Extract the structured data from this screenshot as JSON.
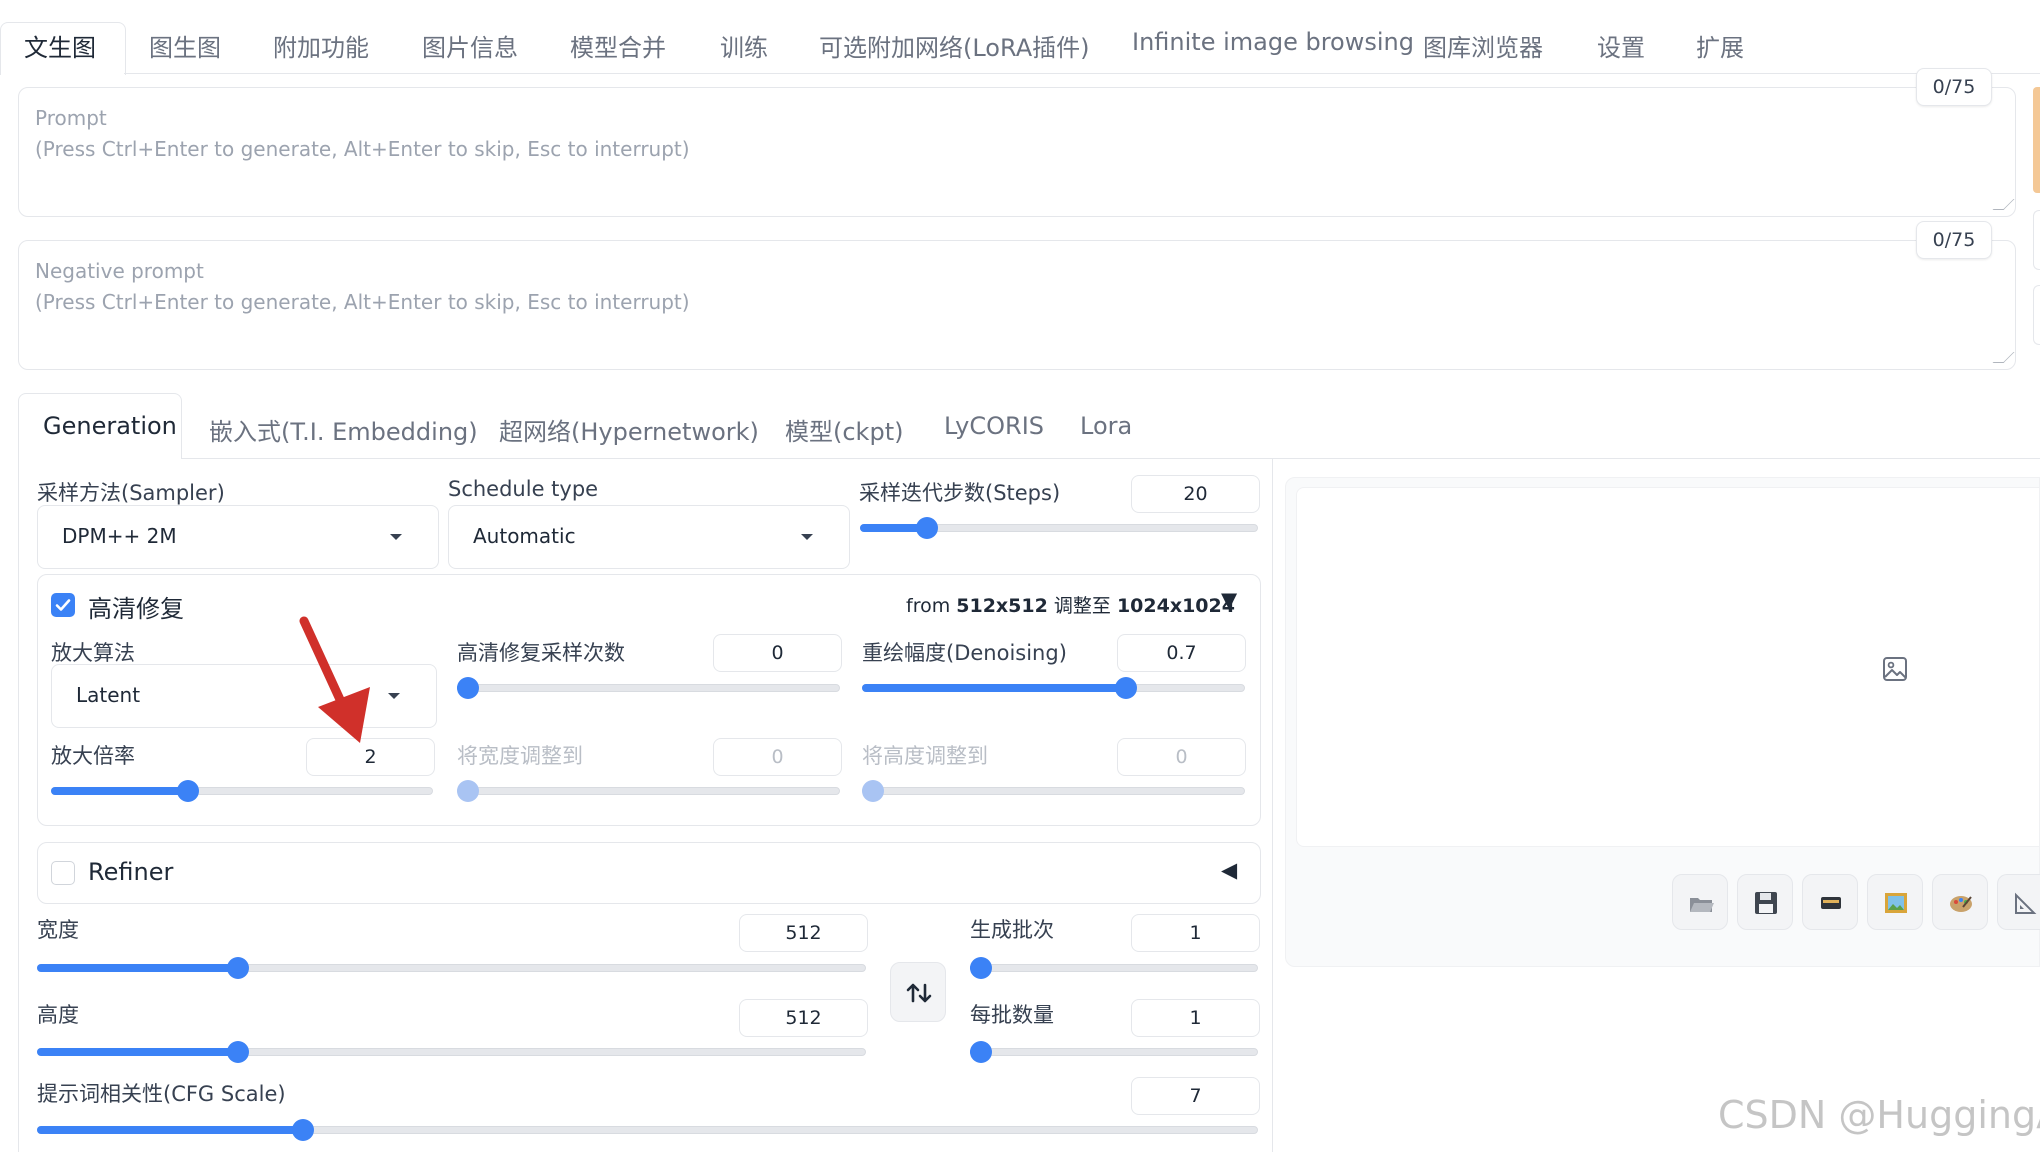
{
  "top_tabs": [
    "文生图",
    "图生图",
    "附加功能",
    "图片信息",
    "模型合并",
    "训练",
    "可选附加网络(LoRA插件)",
    "Infinite image browsing",
    "图库浏览器",
    "设置",
    "扩展"
  ],
  "prompt": {
    "label": "Prompt",
    "hint": "(Press Ctrl+Enter to generate, Alt+Enter to skip, Esc to interrupt)",
    "counter": "0/75"
  },
  "negative_prompt": {
    "label": "Negative prompt",
    "hint": "(Press Ctrl+Enter to generate, Alt+Enter to skip, Esc to interrupt)",
    "counter": "0/75"
  },
  "sub_tabs": [
    "Generation",
    "嵌入式(T.I. Embedding)",
    "超网络(Hypernetwork)",
    "模型(ckpt)",
    "LyCORIS",
    "Lora"
  ],
  "sampler": {
    "label": "采样方法(Sampler)",
    "value": "DPM++ 2M"
  },
  "schedule": {
    "label": "Schedule type",
    "value": "Automatic"
  },
  "steps": {
    "label": "采样迭代步数(Steps)",
    "value": "20",
    "fraction": 0.15
  },
  "hires": {
    "label": "高清修复",
    "checked": true,
    "info_from": "from",
    "info_src": "512x512",
    "info_mid": "调整至",
    "info_dst": "1024x1024",
    "collapse_glyph": "▼",
    "upscaler": {
      "label": "放大算法",
      "value": "Latent"
    },
    "steps": {
      "label": "高清修复采样次数",
      "value": "0",
      "fraction": 0.0
    },
    "denoising": {
      "label": "重绘幅度(Denoising)",
      "value": "0.7",
      "fraction": 0.7
    },
    "scale": {
      "label": "放大倍率",
      "value": "2",
      "fraction": 0.35
    },
    "resize_width": {
      "label": "将宽度调整到",
      "value": "0",
      "fraction": 0.0
    },
    "resize_height": {
      "label": "将高度调整到",
      "value": "0",
      "fraction": 0.0
    }
  },
  "refiner": {
    "label": "Refiner",
    "checked": false,
    "expand_glyph": "◀"
  },
  "width": {
    "label": "宽度",
    "value": "512",
    "fraction": 0.235
  },
  "height": {
    "label": "高度",
    "value": "512",
    "fraction": 0.235
  },
  "batch_count": {
    "label": "生成批次",
    "value": "1",
    "fraction": 0.0
  },
  "batch_size": {
    "label": "每批数量",
    "value": "1",
    "fraction": 0.0
  },
  "cfg": {
    "label": "提示词相关性(CFG Scale)",
    "value": "7",
    "fraction": 0.213
  },
  "watermark": "CSDN @HuggingAI",
  "icons": {
    "swap": "swap-dimensions-icon",
    "image_placeholder": "image-placeholder-icon",
    "tools": [
      "open-folder-icon",
      "save-icon",
      "zip-icon",
      "send-to-img2img-icon",
      "send-to-inpaint-icon",
      "send-to-extras-icon"
    ]
  },
  "colors": {
    "accent": "#3b82f6",
    "annotation_arrow": "#d0302a"
  }
}
